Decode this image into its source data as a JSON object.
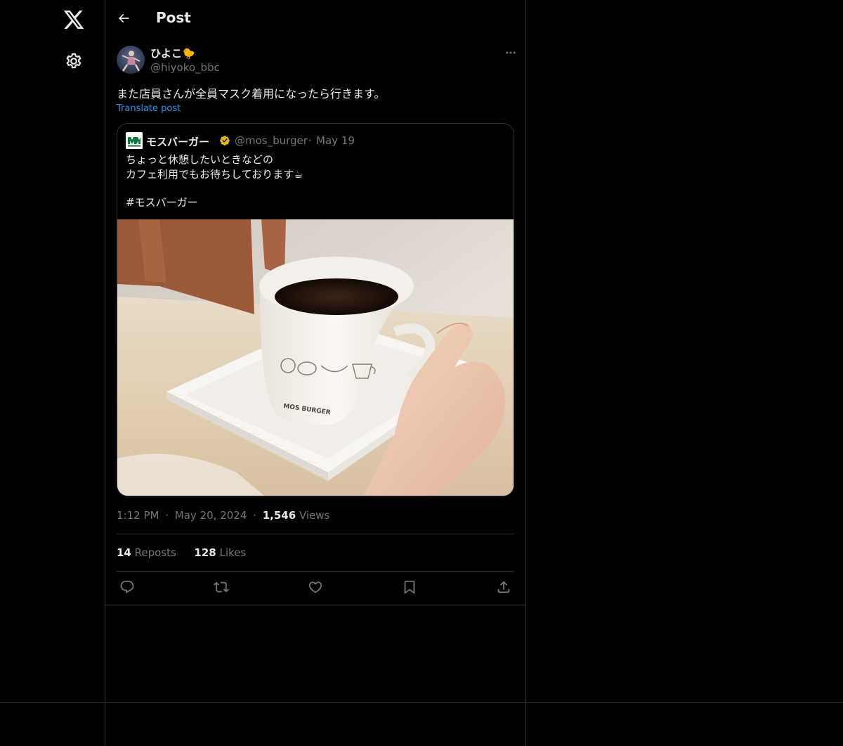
{
  "header": {
    "title": "Post"
  },
  "author": {
    "name": "ひよこ",
    "emoji": "🐤",
    "handle": "@hiyoko_bbc"
  },
  "post": {
    "text": "また店員さんが全員マスク着用になったら行きます。",
    "translate_label": "Translate post"
  },
  "quote": {
    "name": "モスバーガー",
    "handle": "@mos_burger",
    "dot": "·",
    "date": "May 19",
    "lines": [
      "ちょっと休憩したいときなどの",
      "カフェ利用でもお待ちしております☕",
      "",
      "#モスバーガー"
    ],
    "image_text": "MOS BURGER"
  },
  "meta": {
    "time": "1:12 PM",
    "dot1": "·",
    "date": "May 20, 2024",
    "dot2": "·",
    "views_count": "1,546",
    "views_label": "Views"
  },
  "stats": {
    "reposts_count": "14",
    "reposts_label": "Reposts",
    "likes_count": "128",
    "likes_label": "Likes"
  },
  "icons": [
    "x-logo-icon",
    "gear-icon",
    "back-arrow-icon",
    "more-icon",
    "verified-icon",
    "reply-icon",
    "repost-icon",
    "like-icon",
    "bookmark-icon",
    "share-icon"
  ],
  "colors": {
    "background": "#000000",
    "text": "#e7e9ea",
    "muted": "#71767b",
    "link": "#1d9bf0",
    "border": "#2f3336",
    "verified": "#e2b719"
  }
}
